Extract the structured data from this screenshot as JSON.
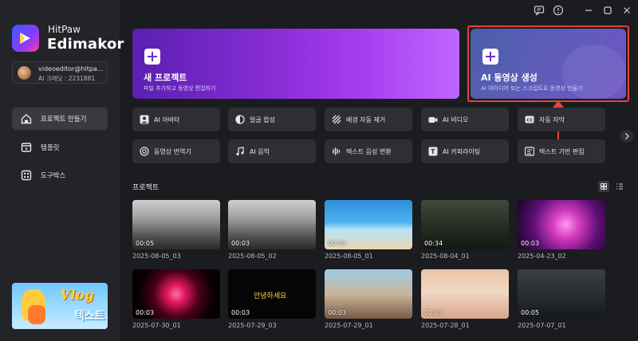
{
  "app": {
    "brand_sub": "HitPaw",
    "brand_main": "Edimakor"
  },
  "account": {
    "email": "videoeditor@hitpa...",
    "credits": "AI 크레딧 : 2231881"
  },
  "sidebar": {
    "items": [
      {
        "label": "프로젝트 만들기",
        "icon": "home-icon",
        "active": true
      },
      {
        "label": "템플릿",
        "icon": "template-icon",
        "active": false
      },
      {
        "label": "도구박스",
        "icon": "toolbox-icon",
        "active": false
      }
    ]
  },
  "banner": {
    "title": "Vlog",
    "subtitle": "텍스트"
  },
  "hero": {
    "new_project": {
      "title": "새 프로젝트",
      "desc": "파일 추가하고 동영상 편집하기"
    },
    "ai_video": {
      "title": "AI 동영상 생성",
      "desc": "AI 아이디어 또는 스크립트로 동영상 만들기"
    }
  },
  "tools": [
    {
      "label": "AI 아바타",
      "icon": "avatar-icon"
    },
    {
      "label": "얼굴 합성",
      "icon": "face-swap-icon"
    },
    {
      "label": "배경 자동 제거",
      "icon": "background-remove-icon"
    },
    {
      "label": "AI 비디오",
      "icon": "ai-video-icon"
    },
    {
      "label": "자동 자막",
      "icon": "caption-icon"
    },
    {
      "label": "동영상 번역기",
      "icon": "translate-icon"
    },
    {
      "label": "AI 음악",
      "icon": "music-icon"
    },
    {
      "label": "텍스트 음성 변환",
      "icon": "tts-icon"
    },
    {
      "label": "AI 카피라이팅",
      "icon": "copywriting-icon"
    },
    {
      "label": "텍스트 기반 편집",
      "icon": "text-edit-icon"
    }
  ],
  "projects_section": {
    "title": "프로젝트"
  },
  "projects": [
    {
      "name": "2025-08-05_03",
      "duration": "00:05",
      "thumb": "ruins"
    },
    {
      "name": "2025-08-05_02",
      "duration": "00:03",
      "thumb": "ruins"
    },
    {
      "name": "2025-08-05_01",
      "duration": "00:03",
      "thumb": "beach"
    },
    {
      "name": "2025-08-04_01",
      "duration": "00:34",
      "thumb": "dark"
    },
    {
      "name": "2025-04-23_02",
      "duration": "00:03",
      "thumb": "tunnel"
    },
    {
      "name": "2025-07-30_01",
      "duration": "00:03",
      "thumb": "burst"
    },
    {
      "name": "2025-07-29_03",
      "duration": "00:03",
      "thumb": "black",
      "overlay_text": "안녕하세요"
    },
    {
      "name": "2025-07-29_01",
      "duration": "00:03",
      "thumb": "couple"
    },
    {
      "name": "2025-07-28_01",
      "duration": "00:03",
      "thumb": "room"
    },
    {
      "name": "2025-07-07_01",
      "duration": "00:05",
      "thumb": "hamster"
    }
  ],
  "colors": {
    "accent_red": "#e2453a",
    "bg": "#1b1c20",
    "sidebar_bg": "#232428",
    "purple": "#8a2ed8"
  }
}
